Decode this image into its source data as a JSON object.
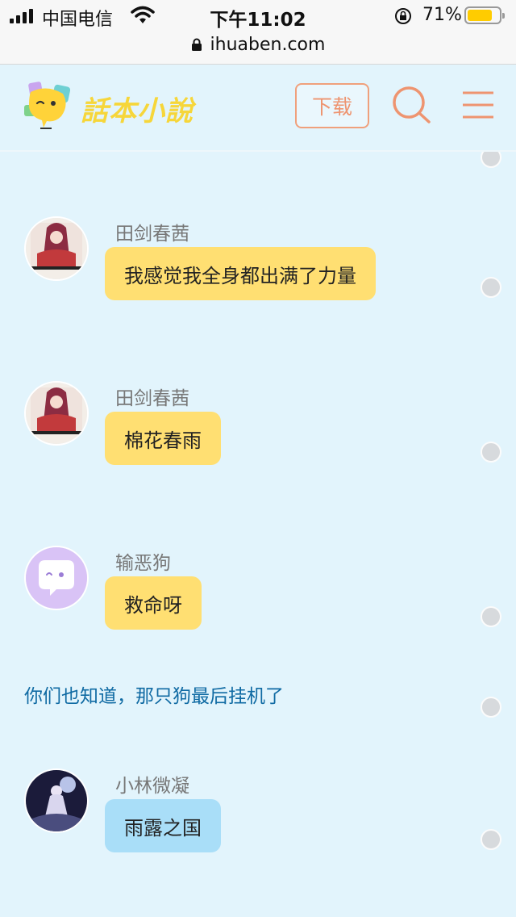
{
  "status_bar": {
    "carrier": "中国电信",
    "time": "下午11:02",
    "battery_pct": "71%",
    "url": "ihuaben.com",
    "battery_color": "#ffcc00"
  },
  "header": {
    "logo_text": "話本小說",
    "download_label": "下载",
    "accent": "#ee9470",
    "search_icon": "search-icon",
    "menu_icon": "menu-icon"
  },
  "messages": [
    {
      "sender": "田剑春茜",
      "text": "我感觉我全身都出满了力量",
      "style": "yellow"
    },
    {
      "sender": "田剑春茜",
      "text": "棉花春雨",
      "style": "yellow"
    },
    {
      "sender": "输恶狗",
      "text": "救命呀",
      "style": "yellow"
    },
    {
      "sender": "小林微凝",
      "text": "雨露之国",
      "style": "blue"
    }
  ],
  "narration": "你们也知道，那只狗最后挂机了"
}
